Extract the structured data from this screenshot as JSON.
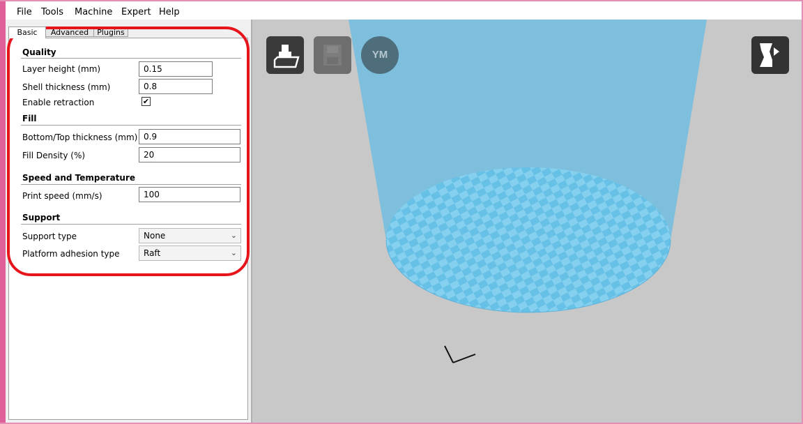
{
  "menu": [
    "File",
    "Tools",
    "Machine",
    "Expert",
    "Help"
  ],
  "tabs": [
    "Basic",
    "Advanced",
    "Plugins"
  ],
  "sections": {
    "quality": "Quality",
    "fill": "Fill",
    "speed": "Speed and Temperature",
    "support": "Support"
  },
  "fields": {
    "layer_height": {
      "label": "Layer height (mm)",
      "value": "0.15"
    },
    "shell_thickness": {
      "label": "Shell thickness (mm)",
      "value": "0.8"
    },
    "enable_retraction": {
      "label": "Enable retraction",
      "checked": true,
      "mark": "✔"
    },
    "bottom_top_thickness": {
      "label": "Bottom/Top thickness (mm)",
      "value": "0.9"
    },
    "fill_density": {
      "label": "Fill Density (%)",
      "value": "20"
    },
    "print_speed": {
      "label": "Print speed (mm/s)",
      "value": "100"
    },
    "support_type": {
      "label": "Support type",
      "value": "None"
    },
    "platform_adhesion": {
      "label": "Platform adhesion type",
      "value": "Raft"
    }
  },
  "toolbar": {
    "load_icon": "load-model-icon",
    "save_icon": "save-icon",
    "ym_label": "YM",
    "view_mode_icon": "view-mode-icon"
  },
  "colors": {
    "highlight": "#e8141c",
    "build_volume": "#7dbfdc",
    "viewport_bg": "#c8c8c8"
  }
}
